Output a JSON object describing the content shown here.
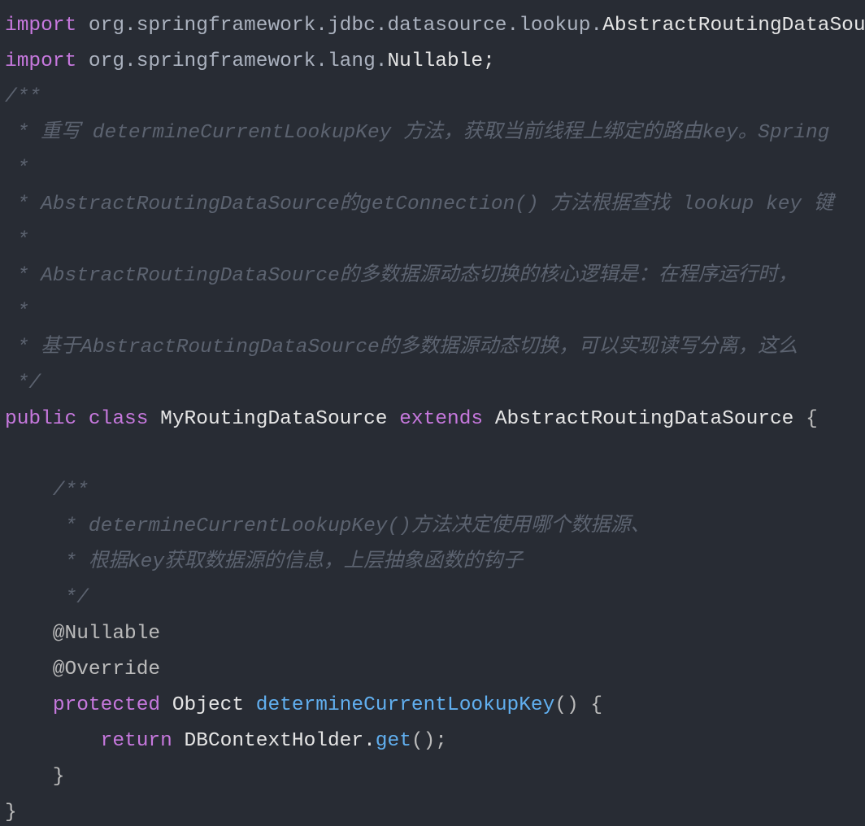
{
  "colors": {
    "background": "#282c34",
    "keyword": "#c678dd",
    "function": "#61afef",
    "comment": "#5c6370",
    "text": "#bbbbbb"
  },
  "code": {
    "l1": {
      "kw": "import",
      "pkg": " org.springframework.jdbc.datasource.lookup.",
      "cls": "AbstractRoutingDataSource;"
    },
    "l2": {
      "kw": "import",
      "pkg": " org.springframework.lang.",
      "cls": "Nullable;"
    },
    "l3": {
      "text": "/**"
    },
    "l4": {
      "text": " * 重写 determineCurrentLookupKey 方法，获取当前线程上绑定的路由key。Spring"
    },
    "l5": {
      "text": " *"
    },
    "l6": {
      "text": " * AbstractRoutingDataSource的getConnection() 方法根据查找 lookup key 键"
    },
    "l7": {
      "text": " *"
    },
    "l8": {
      "text": " * AbstractRoutingDataSource的多数据源动态切换的核心逻辑是：在程序运行时，"
    },
    "l9": {
      "text": " *"
    },
    "l10": {
      "text": " * 基于AbstractRoutingDataSource的多数据源动态切换，可以实现读写分离，这么"
    },
    "l11": {
      "text": " */"
    },
    "l12": {
      "kw1": "public",
      "kw2": "class",
      "name": "MyRoutingDataSource",
      "kw3": "extends",
      "parent": "AbstractRoutingDataSource",
      "brace": "{"
    },
    "l13": {
      "text": ""
    },
    "l14": {
      "text": "    /**"
    },
    "l15": {
      "text": "     * determineCurrentLookupKey()方法决定使用哪个数据源、"
    },
    "l16": {
      "text": "     * 根据Key获取数据源的信息，上层抽象函数的钩子"
    },
    "l17": {
      "text": "     */"
    },
    "l18": {
      "text": "    @Nullable"
    },
    "l19": {
      "text": "    @Override"
    },
    "l20": {
      "kw": "protected",
      "type": "Object",
      "fn": "determineCurrentLookupKey",
      "rest": "() {"
    },
    "l21": {
      "kw": "return",
      "obj": "DBContextHolder.",
      "fn": "get",
      "rest": "();"
    },
    "l22": {
      "text": "    }"
    },
    "l23": {
      "text": "}"
    }
  }
}
